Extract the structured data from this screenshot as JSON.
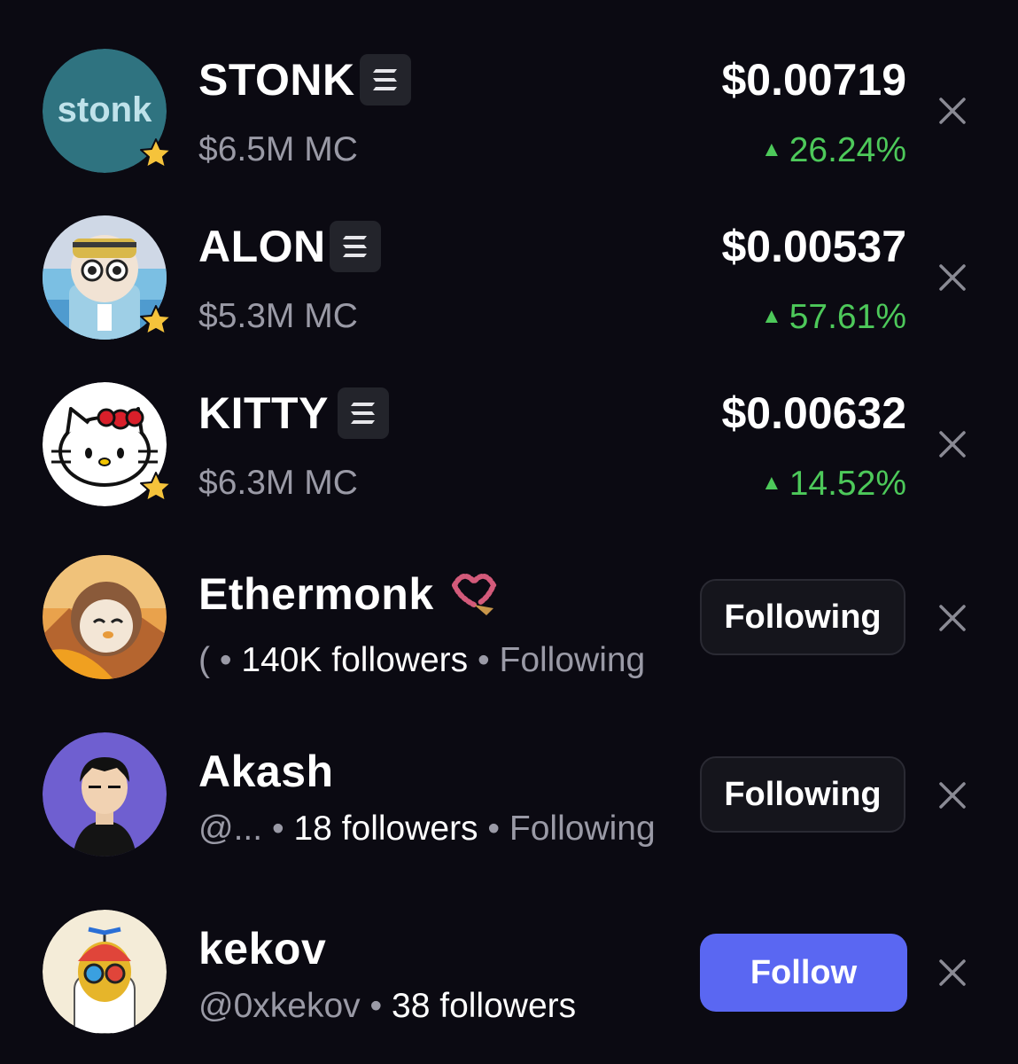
{
  "tokens": [
    {
      "symbol": "STONK",
      "market_cap": "$6.5M MC",
      "price": "$0.00719",
      "change": "26.24%",
      "avatar_text": "stonk"
    },
    {
      "symbol": "ALON",
      "market_cap": "$5.3M MC",
      "price": "$0.00537",
      "change": "57.61%"
    },
    {
      "symbol": "KITTY",
      "market_cap": "$6.3M MC",
      "price": "$0.00632",
      "change": "14.52%"
    }
  ],
  "users": [
    {
      "name": "Ethermonk",
      "handle": "(",
      "followers": "140K followers",
      "status": "Following",
      "button": "Following"
    },
    {
      "name": "Akash",
      "handle": "@...",
      "followers": "18 followers",
      "status": "Following",
      "button": "Following"
    },
    {
      "name": "kekov",
      "handle": "@0xkekov",
      "followers": "38 followers",
      "button": "Follow"
    }
  ],
  "separator": "•",
  "change_arrow": "▲",
  "colors": {
    "background": "#0b0a12",
    "positive": "#4dc95a",
    "muted_text": "#9a9aa6",
    "follow_button": "#5a67f2",
    "following_button": "#15151c",
    "star": "#f5c33b",
    "chain_badge": "#23242b"
  },
  "icons": [
    "star-icon",
    "solana-chain-icon",
    "close-icon",
    "prayer-beads-icon"
  ]
}
